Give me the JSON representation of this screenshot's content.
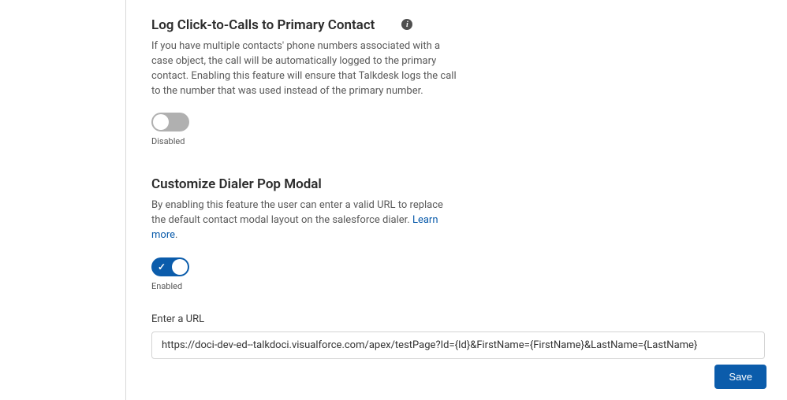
{
  "section1": {
    "title": "Log Click-to-Calls to Primary Contact",
    "description": "If you have multiple contacts' phone numbers associated with a case object, the call will be automatically logged to the primary contact. Enabling this feature will ensure that Talkdesk logs the call to the number that was used instead of the primary number.",
    "toggle_state": "Disabled"
  },
  "section2": {
    "title": "Customize Dialer Pop Modal",
    "description": "By enabling this feature the user can enter a valid URL to replace the default contact modal layout on the salesforce dialer.",
    "learn_more": "Learn more",
    "toggle_state": "Enabled"
  },
  "url_field": {
    "label": "Enter a URL",
    "value": "https://doci-dev-ed--talkdoci.visualforce.com/apex/testPage?Id={Id}&FirstName={FirstName}&LastName={LastName}"
  },
  "actions": {
    "save": "Save"
  },
  "info_glyph": "i"
}
